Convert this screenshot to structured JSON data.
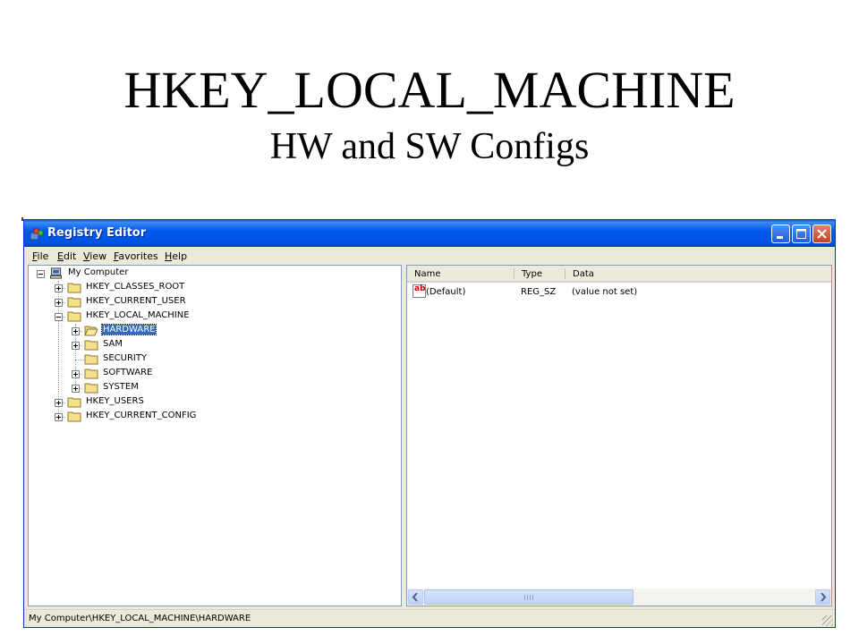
{
  "slide": {
    "title": "HKEY_LOCAL_MACHINE",
    "subtitle": "HW and SW Configs"
  },
  "window": {
    "title": "Registry Editor",
    "icon": "registry-editor-icon",
    "controls": [
      "minimize-icon",
      "maximize-icon",
      "close-icon"
    ]
  },
  "menu": {
    "items": [
      {
        "accel": "F",
        "rest": "ile"
      },
      {
        "accel": "E",
        "rest": "dit"
      },
      {
        "accel": "V",
        "rest": "iew"
      },
      {
        "accel": "F",
        "rest": "avorites",
        "pre": ""
      },
      {
        "accel": "H",
        "rest": "elp"
      }
    ]
  },
  "tree": {
    "nodes": [
      {
        "label": "My Computer",
        "level": 0,
        "expander": "minus",
        "icon": "computer-icon"
      },
      {
        "label": "HKEY_CLASSES_ROOT",
        "level": 1,
        "expander": "plus",
        "icon": "folder-icon"
      },
      {
        "label": "HKEY_CURRENT_USER",
        "level": 1,
        "expander": "plus",
        "icon": "folder-icon"
      },
      {
        "label": "HKEY_LOCAL_MACHINE",
        "level": 1,
        "expander": "minus",
        "icon": "folder-icon"
      },
      {
        "label": "HARDWARE",
        "level": 2,
        "expander": "plus",
        "icon": "open-folder-icon",
        "selected": true
      },
      {
        "label": "SAM",
        "level": 2,
        "expander": "plus",
        "icon": "folder-icon"
      },
      {
        "label": "SECURITY",
        "level": 2,
        "expander": "none",
        "icon": "folder-icon"
      },
      {
        "label": "SOFTWARE",
        "level": 2,
        "expander": "plus",
        "icon": "folder-icon"
      },
      {
        "label": "SYSTEM",
        "level": 2,
        "expander": "plus",
        "icon": "folder-icon"
      },
      {
        "label": "HKEY_USERS",
        "level": 1,
        "expander": "plus",
        "icon": "folder-icon"
      },
      {
        "label": "HKEY_CURRENT_CONFIG",
        "level": 1,
        "expander": "plus",
        "icon": "folder-icon"
      }
    ]
  },
  "list": {
    "columns": [
      "Name",
      "Type",
      "Data"
    ],
    "rows": [
      {
        "icon": "string-value-icon",
        "icon_text": "ab",
        "name": "(Default)",
        "type": "REG_SZ",
        "data": "(value not set)"
      }
    ]
  },
  "statusbar": {
    "path": "My Computer\\HKEY_LOCAL_MACHINE\\HARDWARE"
  },
  "colors": {
    "titlebar": "#0058ee",
    "selection": "#316ac5",
    "chrome": "#ece9d8"
  }
}
